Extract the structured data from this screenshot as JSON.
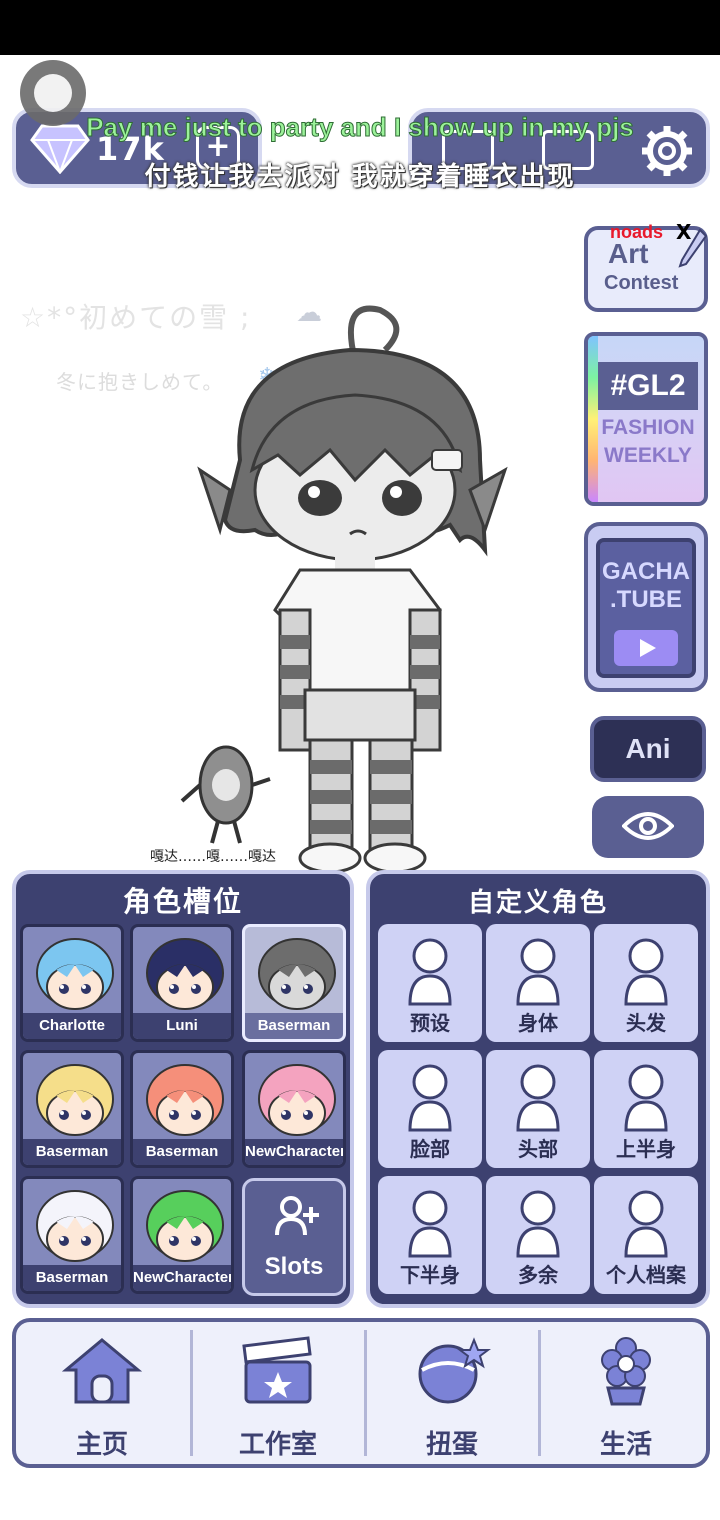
{
  "topbar": {
    "currency_value": "17k",
    "add_label": "+"
  },
  "lyrics": {
    "english": "Pay me just to party and I show up in my pjs",
    "chinese": "付钱让我去派对 我就穿着睡衣出现"
  },
  "side": {
    "noads_label": "noads",
    "close_label": "X",
    "art_title": "Art",
    "art_subtitle": "Contest",
    "gl2_tag": "#GL2",
    "gl2_line1": "FASHION",
    "gl2_line2": "WEEKLY",
    "tube_line1": "GACHA",
    "tube_line2": ".TUBE",
    "ani_label": "Ani"
  },
  "overlay_text": {
    "jp_line1": "☆*°初めての雪 ;",
    "jp_line2": "冬に抱きしめて。",
    "snow_glyph": "❄",
    "cloud_glyph": "☁",
    "sfx": "嘎达……嘎……嘎达"
  },
  "slots_panel": {
    "title": "角色槽位",
    "slots": [
      {
        "name": "Charlotte",
        "hair": "#7cc6f0",
        "skin": "#fde8d8"
      },
      {
        "name": "Luni",
        "hair": "#2a2f66",
        "skin": "#fde8d8"
      },
      {
        "name": "Baserman",
        "hair": "#6d6d6d",
        "skin": "#d9d9d9"
      },
      {
        "name": "Baserman",
        "hair": "#f5de8a",
        "skin": "#fde8d8"
      },
      {
        "name": "Baserman",
        "hair": "#f58f7a",
        "skin": "#fde8d8"
      },
      {
        "name": "NewCharacter",
        "hair": "#f4a3bf",
        "skin": "#fde8d8"
      },
      {
        "name": "Baserman",
        "hair": "#f4f4fb",
        "skin": "#fde8d8"
      },
      {
        "name": "NewCharacter",
        "hair": "#57cf5c",
        "skin": "#fde8d8"
      }
    ],
    "add_slots_label": "Slots"
  },
  "customize_panel": {
    "title": "自定义角色",
    "categories": [
      {
        "label": "预设",
        "icon": "presets-icon"
      },
      {
        "label": "身体",
        "icon": "body-icon"
      },
      {
        "label": "头发",
        "icon": "hair-icon"
      },
      {
        "label": "脸部",
        "icon": "face-icon"
      },
      {
        "label": "头部",
        "icon": "head-accessory-icon"
      },
      {
        "label": "上半身",
        "icon": "upper-body-icon"
      },
      {
        "label": "下半身",
        "icon": "lower-body-icon"
      },
      {
        "label": "多余",
        "icon": "extra-icon"
      },
      {
        "label": "个人档案",
        "icon": "profile-icon"
      }
    ]
  },
  "bottom_nav": {
    "items": [
      {
        "label": "主页",
        "icon": "home-icon"
      },
      {
        "label": "工作室",
        "icon": "studio-clapper-icon"
      },
      {
        "label": "扭蛋",
        "icon": "gacha-icon"
      },
      {
        "label": "生活",
        "icon": "life-flower-icon"
      }
    ]
  },
  "colors": {
    "panel_bg": "#3d4170",
    "accent": "#5a5f92",
    "tile_bg": "#cfd2f5",
    "lyric_green": "#9cf29a"
  }
}
